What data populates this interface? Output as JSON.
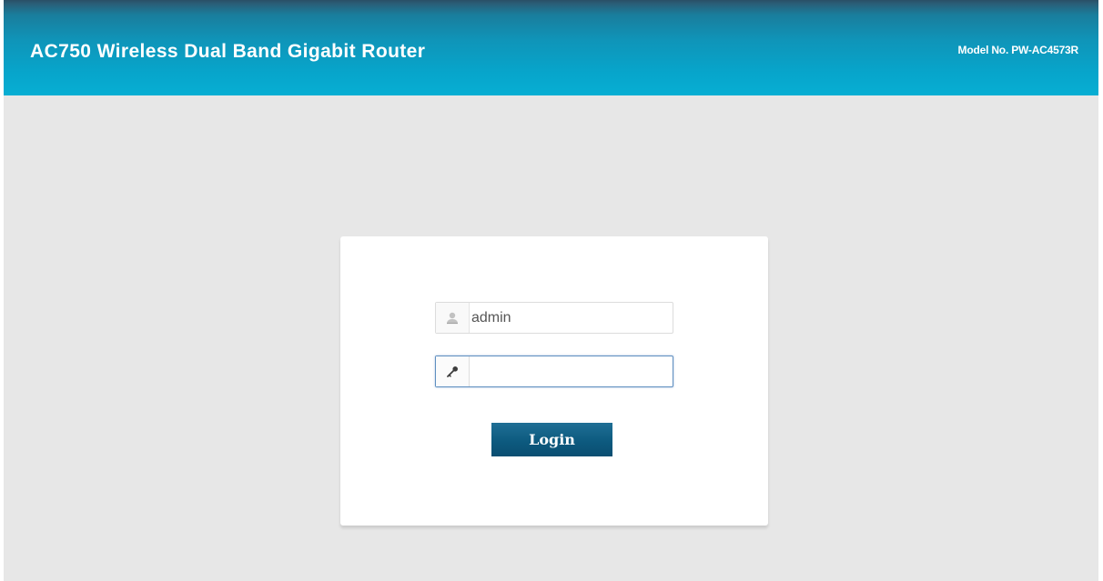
{
  "header": {
    "title": "AC750 Wireless Dual Band Gigabit Router",
    "model": "Model No. PW-AC4573R"
  },
  "login": {
    "username_value": "admin",
    "password_value": "",
    "button_label": "Login",
    "username_icon": "user-icon",
    "password_icon": "key-icon"
  },
  "colors": {
    "header_top": "#2a4f66",
    "header_bottom": "#07aed3",
    "page_background": "#e7e7e7",
    "button": "#0d5a7f",
    "focus_border": "#5f8fc0"
  }
}
